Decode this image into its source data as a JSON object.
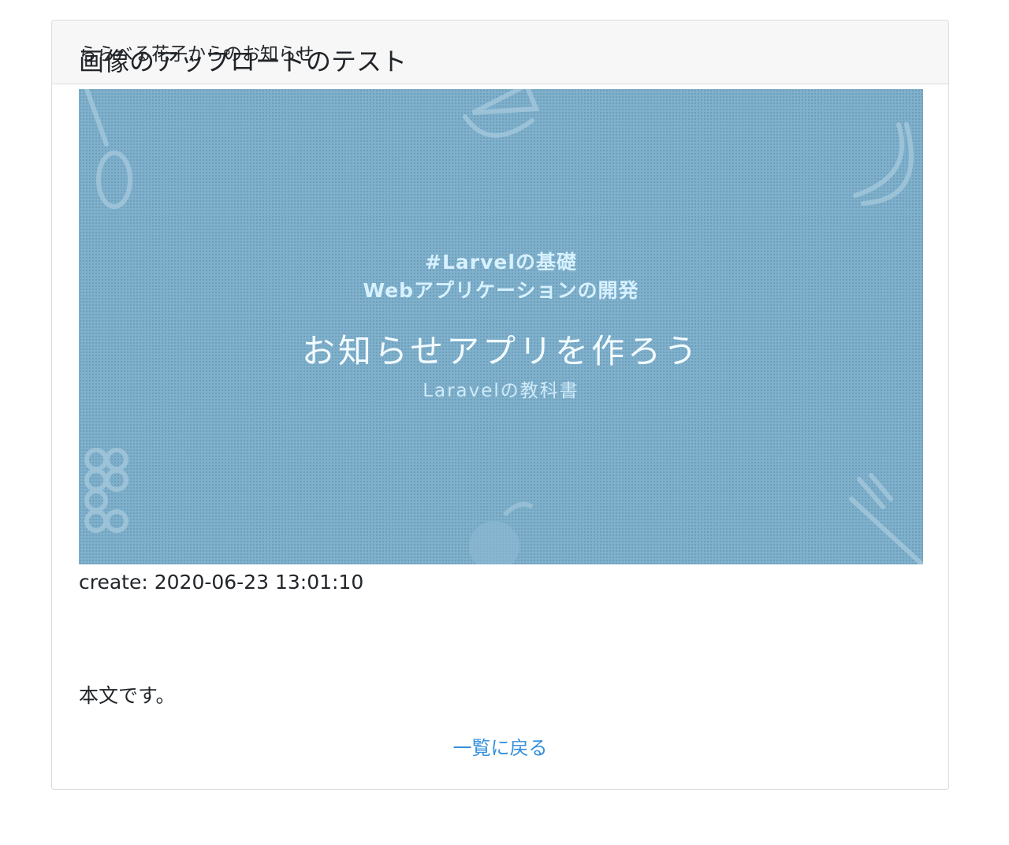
{
  "card": {
    "header_title": "ららべる花子からのお知らせ"
  },
  "post": {
    "title": "画像のアップロードのテスト",
    "image": {
      "tag_line": "#Larvelの基礎",
      "sub_line": "Webアプリケーションの開発",
      "main_line": "お知らせアプリを作ろう",
      "small_line": "Laravelの教科書",
      "background_color": "#7fb0cc",
      "decor_icons": [
        "spoon-icon",
        "watermelon-icon",
        "banana-icon",
        "grapes-icon",
        "orange-icon",
        "fork-icon"
      ]
    },
    "created_label": "create: 2020-06-23 13:01:10",
    "body": "本文です。",
    "back_link": "一覧に戻る"
  },
  "colors": {
    "link": "#3490dc",
    "header_bg": "#f7f7f7",
    "border": "#dcdcdc"
  }
}
